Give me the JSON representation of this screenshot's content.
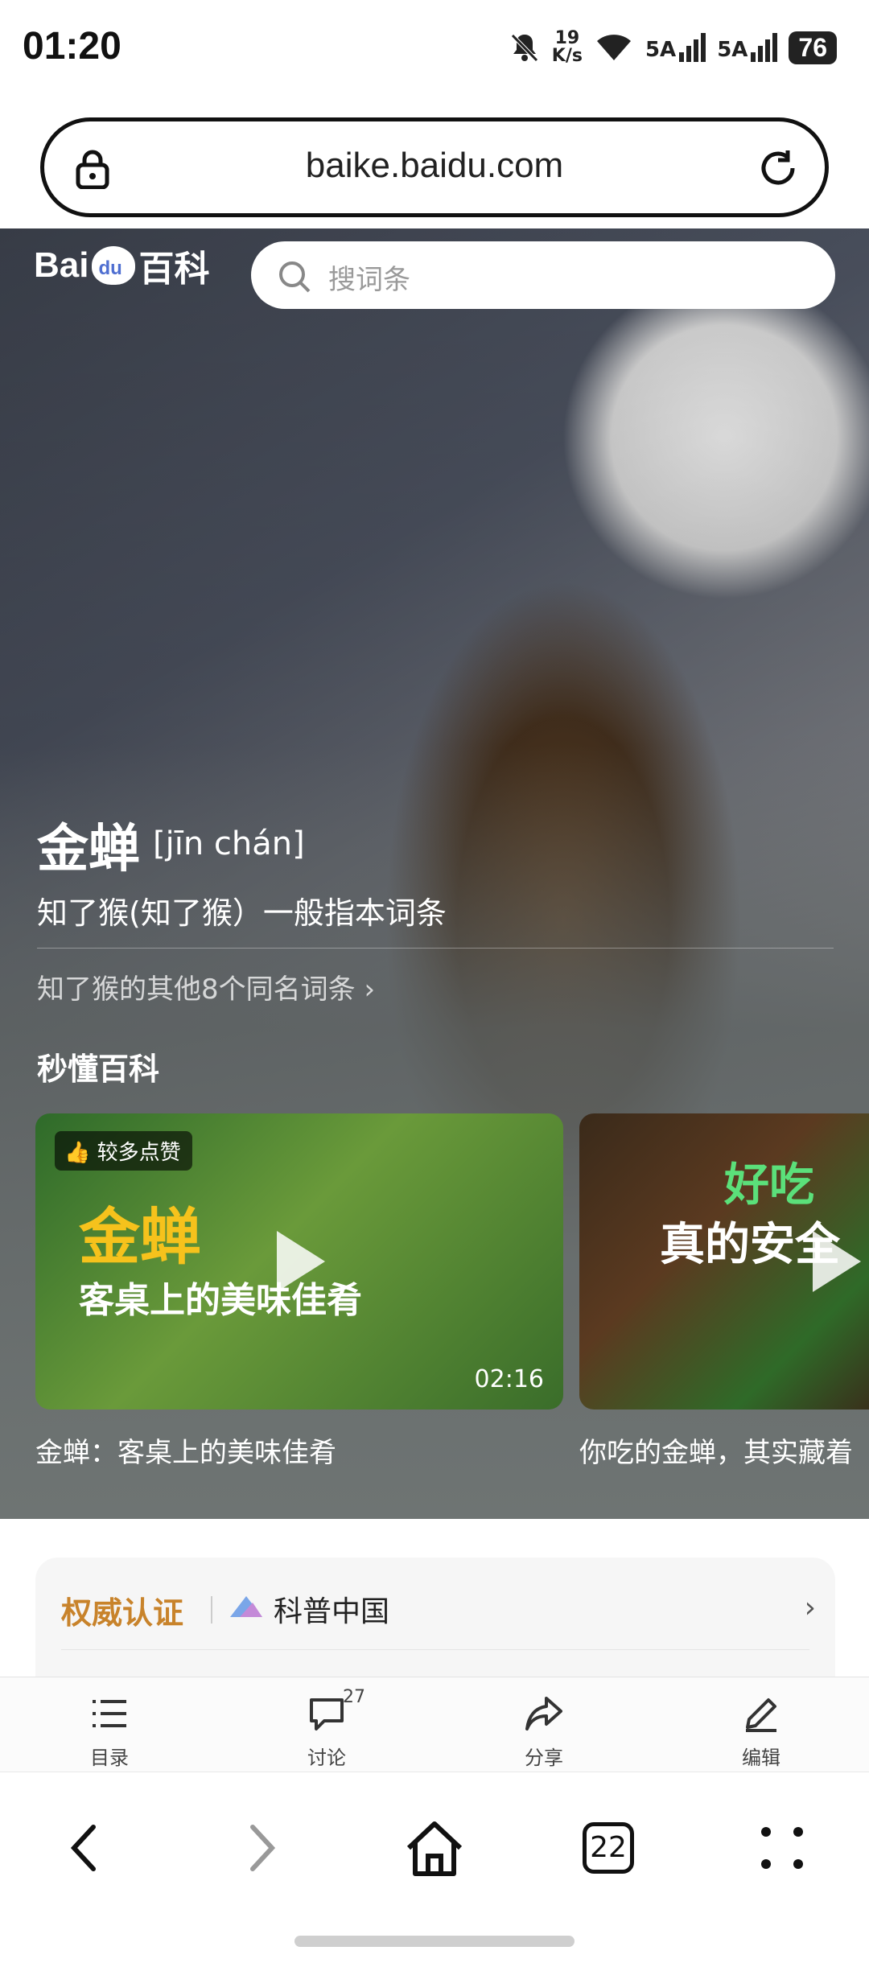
{
  "status_bar": {
    "time": "01:20",
    "net_speed_value": "19",
    "net_speed_unit": "K/s",
    "signal1_label": "5A",
    "signal2_label": "5A",
    "battery": "76",
    "icons": [
      "bell-off-icon",
      "wifi-icon",
      "signal-icon",
      "signal-icon",
      "battery-icon"
    ]
  },
  "browser": {
    "url": "baike.baidu.com",
    "lock_icon": "lock-icon",
    "reload_icon": "reload-icon"
  },
  "baike_header": {
    "logo_prefix": "Bai",
    "logo_paw_text": "du",
    "logo_suffix": "百科",
    "search_placeholder": "搜词条"
  },
  "entry": {
    "title": "金蝉",
    "pinyin": "[jīn chán]",
    "subtitle": "知了猴(知了猴）一般指本词条",
    "same_name_link": "知了猴的其他8个同名词条",
    "section_title": "秒懂百科"
  },
  "videos": [
    {
      "badge": "较多点赞",
      "overlay_title": "金蝉",
      "overlay_subtitle": "客桌上的美味佳肴",
      "duration": "02:16",
      "caption": "金蝉：客桌上的美味佳肴"
    },
    {
      "overlay_title": "好吃",
      "overlay_subtitle": "真的安全",
      "caption": "你吃的金蝉，其实藏着"
    }
  ],
  "authority": {
    "label": "权威认证",
    "org": "科普中国"
  },
  "toolbar": {
    "items": [
      {
        "label": "目录",
        "icon": "list-icon"
      },
      {
        "label": "讨论",
        "icon": "comment-icon",
        "count": "27"
      },
      {
        "label": "分享",
        "icon": "share-icon"
      },
      {
        "label": "编辑",
        "icon": "edit-icon"
      }
    ]
  },
  "nav": {
    "tabs_count": "22"
  },
  "colors": {
    "authority_label": "#c8832b",
    "baidu_blue": "#4f6fd1"
  }
}
